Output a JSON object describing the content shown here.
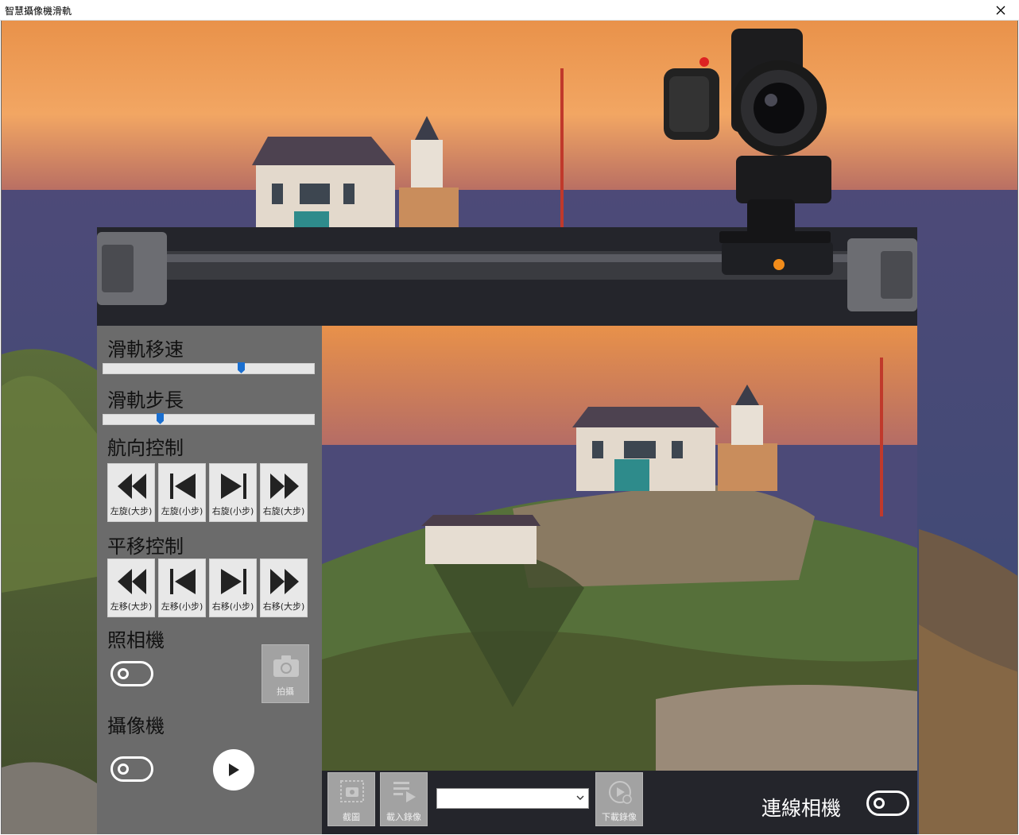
{
  "window": {
    "title": "智慧攝像機滑軌"
  },
  "panel": {
    "speed": {
      "heading": "滑軌移速",
      "value": 0.66
    },
    "step": {
      "heading": "滑軌步長",
      "value": 0.26
    },
    "heading_control": {
      "heading": "航向控制",
      "buttons": [
        {
          "label": "左旋(大步)",
          "icon": "rewind-icon"
        },
        {
          "label": "左旋(小步)",
          "icon": "skip-back-icon"
        },
        {
          "label": "右旋(小步)",
          "icon": "skip-forward-icon"
        },
        {
          "label": "右旋(大步)",
          "icon": "fast-forward-icon"
        }
      ]
    },
    "pan_control": {
      "heading": "平移控制",
      "buttons": [
        {
          "label": "左移(大步)",
          "icon": "rewind-icon"
        },
        {
          "label": "左移(小步)",
          "icon": "skip-back-icon"
        },
        {
          "label": "右移(小步)",
          "icon": "skip-forward-icon"
        },
        {
          "label": "右移(大步)",
          "icon": "fast-forward-icon"
        }
      ]
    },
    "photo": {
      "heading": "照相機",
      "toggle_on": false,
      "shoot_label": "拍攝"
    },
    "video": {
      "heading": "攝像機",
      "toggle_on": false
    }
  },
  "toolbar": {
    "screenshot_label": "截圖",
    "load_video_label": "載入錄像",
    "combo_value": "",
    "download_video_label": "下載錄像",
    "connect_label": "連線相機",
    "connect_on": false
  },
  "colors": {
    "slider_thumb": "#1a6fd0",
    "panel": "#6b6b6b",
    "dark_bar": "#24252b",
    "disabled_button": "#a2a2a2"
  }
}
